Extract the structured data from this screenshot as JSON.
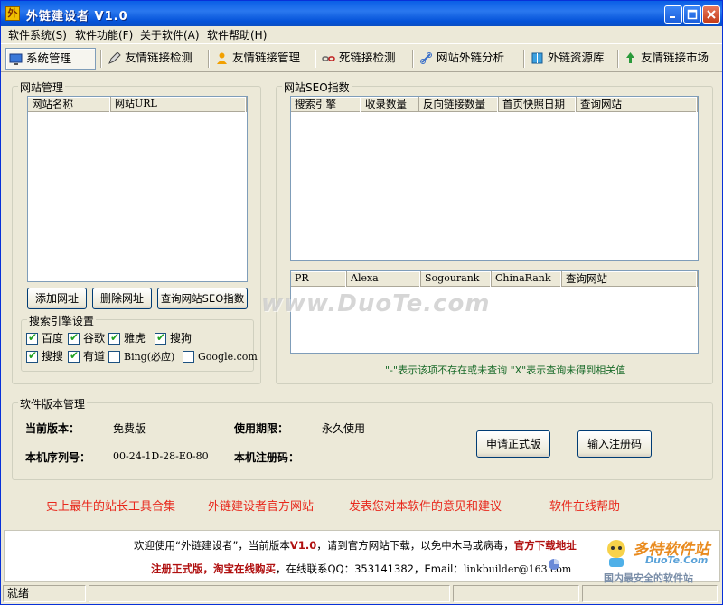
{
  "window": {
    "title": "外链建设者 V1.0"
  },
  "menu": [
    "软件系统(S)",
    "软件功能(F)",
    "关于软件(A)",
    "软件帮助(H)"
  ],
  "toolbar": [
    {
      "label": "系统管理",
      "icon": "monitor-icon"
    },
    {
      "label": "友情链接检测",
      "icon": "pencil-icon"
    },
    {
      "label": "友情链接管理",
      "icon": "user-icon"
    },
    {
      "label": "死链接检测",
      "icon": "broken-link-icon"
    },
    {
      "label": "网站外链分析",
      "icon": "link-icon"
    },
    {
      "label": "外链资源库",
      "icon": "book-icon"
    },
    {
      "label": "友情链接市场",
      "icon": "recycle-icon"
    }
  ],
  "site_manage": {
    "title": "网站管理",
    "columns": [
      "网站名称",
      "网站URL"
    ],
    "buttons": {
      "add": "添加网址",
      "delete": "删除网址",
      "query": "查询网站SEO指数"
    }
  },
  "search_engine": {
    "title": "搜索引擎设置",
    "options": [
      {
        "label": "百度",
        "checked": true
      },
      {
        "label": "谷歌",
        "checked": true
      },
      {
        "label": "雅虎",
        "checked": true
      },
      {
        "label": "搜狗",
        "checked": true
      },
      {
        "label": "搜搜",
        "checked": true
      },
      {
        "label": "有道",
        "checked": true
      },
      {
        "label": "Bing(必应)",
        "checked": false
      },
      {
        "label": "Google.com",
        "checked": false
      }
    ]
  },
  "seo_index": {
    "title": "网站SEO指数",
    "columns_top": [
      "搜索引擎",
      "收录数量",
      "反向链接数量",
      "首页快照日期",
      "查询网站"
    ],
    "columns_bottom": [
      "PR",
      "Alexa",
      "Sogourank",
      "ChinaRank",
      "查询网站"
    ],
    "note": "\"-\"表示该项不存在或未查询 \"X\"表示查询未得到相关值"
  },
  "version": {
    "title": "软件版本管理",
    "current_label": "当前版本：",
    "current_value": "免费版",
    "period_label": "使用期限：",
    "period_value": "永久使用",
    "serial_label": "本机序列号：",
    "serial_value": "00-24-1D-28-E0-80",
    "regcode_label": "本机注册码：",
    "regcode_value": "",
    "apply_button": "申请正式版",
    "enter_button": "输入注册码"
  },
  "links": [
    "史上最牛的站长工具合集",
    "外链建设者官方网站",
    "发表您对本软件的意见和建议",
    "软件在线帮助"
  ],
  "welcome": {
    "line1_pre": "欢迎使用“外链建设者”，当前版本",
    "line1_version": "V1.0",
    "line1_mid": "，请到官方网站下载，以免中木马或病毒，",
    "line1_link": "官方下载地址",
    "line2_reg": "注册正式版，",
    "line2_taobao": "淘宝在线购买",
    "line2_contact": "，在线联系QQ：353141382，Email：",
    "line2_email": "linkbuilder@163.com"
  },
  "status": {
    "text": "就绪"
  },
  "watermarks": {
    "center": "www.DuoTe.com",
    "corner": "多特软件站",
    "corner_sub": "DuoTe.Com",
    "corner_cn": "国内最安全的软件站"
  },
  "colors": {
    "titlebar": "#0a5fe6",
    "link_red": "#e8281c",
    "note_green": "#1a6b2a",
    "window_bg": "#ece9d8"
  }
}
